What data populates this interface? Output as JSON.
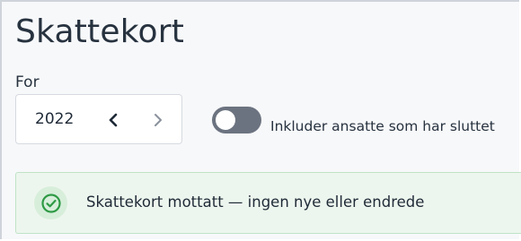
{
  "page": {
    "title": "Skattekort"
  },
  "year_selector": {
    "label": "For",
    "value": "2022",
    "prev_icon": "chevron-left-icon",
    "next_icon": "chevron-right-icon"
  },
  "toggle": {
    "label": "Inkluder ansatte som har sluttet",
    "checked": false
  },
  "alert": {
    "icon": "check-circle-icon",
    "message": "Skattekort mottatt — ingen nye eller endrede"
  },
  "colors": {
    "background": "#f7f8fa",
    "toggle_off": "#6c7380",
    "alert_bg": "#edf6ee",
    "alert_border": "#bfe3c6",
    "success_green": "#2e9a45"
  }
}
